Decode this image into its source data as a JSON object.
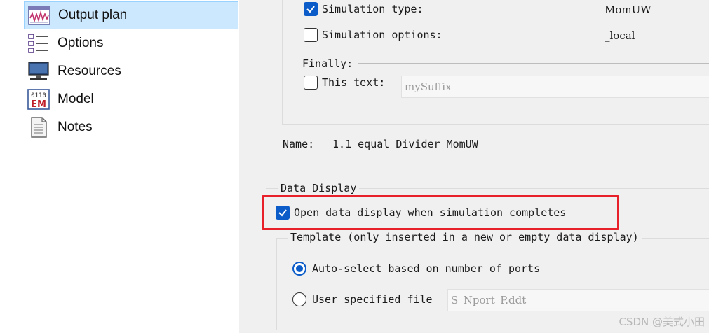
{
  "sidebar": {
    "items": [
      {
        "label": "Output plan",
        "icon": "output-plan-icon",
        "selected": true
      },
      {
        "label": "Options",
        "icon": "options-list-icon",
        "selected": false
      },
      {
        "label": "Resources",
        "icon": "monitor-icon",
        "selected": false
      },
      {
        "label": "Model",
        "icon": "em-model-icon",
        "selected": false
      },
      {
        "label": "Notes",
        "icon": "notes-document-icon",
        "selected": false
      }
    ]
  },
  "output_name": {
    "simulation_type_label": "Simulation type:",
    "simulation_type_checked": true,
    "simulation_type_value": "MomUW",
    "simulation_options_label": "Simulation options:",
    "simulation_options_checked": false,
    "simulation_options_value": "_local",
    "finally_label": "Finally:",
    "this_text_label": "This text:",
    "this_text_checked": false,
    "this_text_value": "mySuffix",
    "name_label": "Name:",
    "name_value": "_1.1_equal_Divider_MomUW"
  },
  "data_display": {
    "legend": "Data Display",
    "open_label": "Open data display when simulation completes",
    "open_checked": true,
    "template": {
      "legend": "Template (only inserted in a new or empty data display)",
      "auto_select_label": "Auto-select based on number of ports",
      "auto_select_selected": true,
      "user_file_label": "User specified file",
      "user_file_selected": false,
      "user_file_value": "S_Nport_P.ddt"
    }
  },
  "watermark": "CSDN @美式小田",
  "colors": {
    "accent": "#0b5cc8",
    "highlight": "#e8202a",
    "selection": "#cce8ff"
  }
}
